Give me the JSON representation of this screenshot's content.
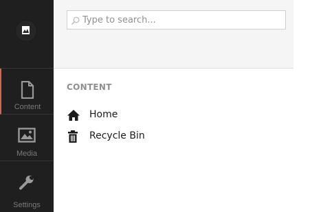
{
  "appbar": {
    "sections": [
      {
        "label": "Content",
        "icon": "document-icon"
      },
      {
        "label": "Media",
        "icon": "image-icon"
      },
      {
        "label": "Settings",
        "icon": "wrench-icon"
      }
    ]
  },
  "search": {
    "placeholder": "Type to search..."
  },
  "tree": {
    "heading": "CONTENT",
    "nodes": [
      {
        "label": "Home",
        "icon": "home-icon"
      },
      {
        "label": "Recycle Bin",
        "icon": "trash-icon"
      }
    ]
  },
  "colors": {
    "appbar_bg": "#1f1f1f",
    "active_accent": "#d2664e",
    "search_area_bg": "#f5f5f5"
  }
}
